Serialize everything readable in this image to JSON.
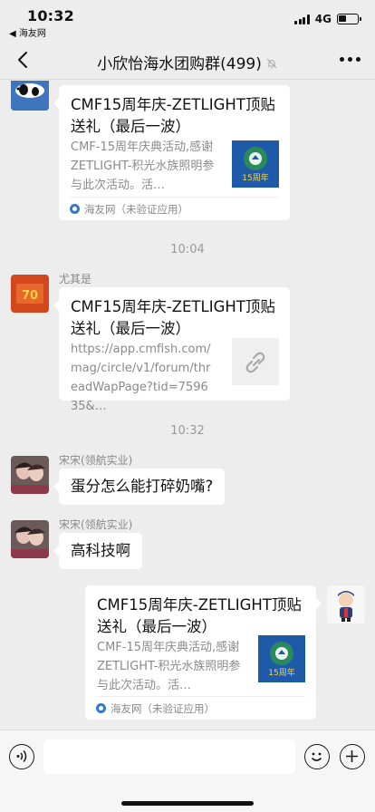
{
  "status_bar": {
    "time": "10:32",
    "back_app": "◀ 海友网",
    "network": "4G",
    "battery_level": 0.4
  },
  "nav": {
    "title": "小欣怡海水团购群(499)",
    "back_icon": "chevron-left-icon",
    "mute_icon": "bell-muted-icon",
    "more_icon": "more-dots-icon"
  },
  "messages": {
    "msg1": {
      "card_title": "CMF15周年庆-ZETLIGHT顶贴送礼（最后一波）",
      "card_desc": "CMF-15周年庆典活动,感谢 ZETLIGHT-积光水族照明参与此次活动。活…",
      "thumb_text": "15周年",
      "source": "海友网（未验证应用）"
    },
    "time1": "10:04",
    "msg2": {
      "sender": "尤其是",
      "avatar_text": "70",
      "card_title": "CMF15周年庆-ZETLIGHT顶贴送礼（最后一波）",
      "card_desc": "https://app.cmfish.com/mag/circle/v1/forum/threadWapPage?tid=759635&…"
    },
    "time2": "10:32",
    "msg3": {
      "sender": "宋宋(领航实业)",
      "text": "蛋分怎么能打碎奶嘴?"
    },
    "msg4": {
      "sender": "宋宋(领航实业)",
      "text": "高科技啊"
    },
    "msg5": {
      "card_title": "CMF15周年庆-ZETLIGHT顶贴送礼（最后一波）",
      "card_desc": "CMF-15周年庆典活动,感谢 ZETLIGHT-积光水族照明参与此次活动。活…",
      "thumb_text": "15周年",
      "source": "海友网（未验证应用）"
    }
  },
  "input_bar": {
    "voice_icon": "voice-icon",
    "emoji_icon": "emoji-icon",
    "plus_icon": "plus-icon"
  },
  "colors": {
    "background": "#ededed",
    "bubble": "#ffffff",
    "thumb_green": "#1f7a4d",
    "thumb_blue": "#1e5aa8"
  }
}
